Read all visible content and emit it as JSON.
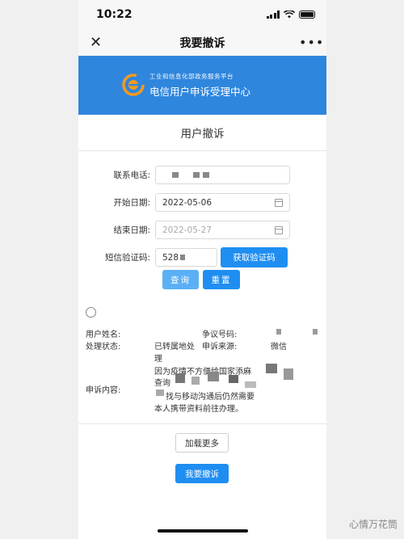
{
  "status": {
    "time": "10:22"
  },
  "nav": {
    "close": "✕",
    "title": "我要撤诉",
    "more": "•••"
  },
  "banner": {
    "subtitle": "工业和信息化部政务服务平台",
    "title": "电信用户申诉受理中心"
  },
  "page_title": "用户撤诉",
  "form": {
    "phone_label": "联系电话:",
    "start_label": "开始日期:",
    "start_value": "2022-05-06",
    "end_label": "结束日期:",
    "end_placeholder": "2022-05-27",
    "sms_label": "短信验证码:",
    "sms_value": "528",
    "get_code": "获取验证码",
    "query": "查询",
    "reset": "重置"
  },
  "record": {
    "name_label": "用户姓名:",
    "dispute_label": "争议号码:",
    "status_label": "处理状态:",
    "status_value_1": "已转属地处",
    "status_value_2": "理",
    "source_label": "申诉来源:",
    "source_value": "微信",
    "content_label": "申诉内容:",
    "content_line1": "因为疫情不方便给国家添麻",
    "content_line2": "查询",
    "content_line3": "找与移动沟通后仍然需要",
    "content_line4": "本人携带资料前往办理。"
  },
  "load_more": "加载更多",
  "complain": "我要撤诉",
  "watermark": "心情万花筒"
}
